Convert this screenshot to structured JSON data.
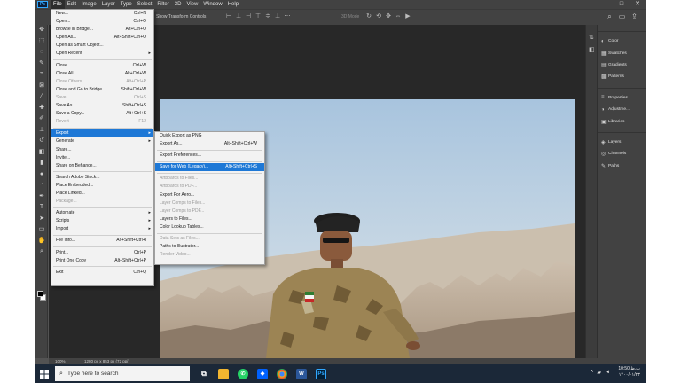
{
  "menubar": {
    "logo": "Ps",
    "items": [
      "File",
      "Edit",
      "Image",
      "Layer",
      "Type",
      "Select",
      "Filter",
      "3D",
      "View",
      "Window",
      "Help"
    ],
    "controls": [
      "–",
      "□",
      "✕"
    ]
  },
  "options": {
    "transform_label": "Show Transform Controls",
    "mode_3d": "3D Mode"
  },
  "file_menu": [
    {
      "label": "New...",
      "shortcut": "Ctrl+N"
    },
    {
      "label": "Open...",
      "shortcut": "Ctrl+O"
    },
    {
      "label": "Browse in Bridge...",
      "shortcut": "Alt+Ctrl+O"
    },
    {
      "label": "Open As...",
      "shortcut": "Alt+Shift+Ctrl+O"
    },
    {
      "label": "Open as Smart Object..."
    },
    {
      "label": "Open Recent",
      "submenu": true
    },
    {
      "sep": true
    },
    {
      "label": "Close",
      "shortcut": "Ctrl+W"
    },
    {
      "label": "Close All",
      "shortcut": "Alt+Ctrl+W"
    },
    {
      "label": "Close Others",
      "shortcut": "Alt+Ctrl+P",
      "disabled": true
    },
    {
      "label": "Close and Go to Bridge...",
      "shortcut": "Shift+Ctrl+W"
    },
    {
      "label": "Save",
      "shortcut": "Ctrl+S",
      "disabled": true
    },
    {
      "label": "Save As...",
      "shortcut": "Shift+Ctrl+S"
    },
    {
      "label": "Save a Copy...",
      "shortcut": "Alt+Ctrl+S"
    },
    {
      "label": "Revert",
      "shortcut": "F12",
      "disabled": true
    },
    {
      "sep": true
    },
    {
      "label": "Export",
      "submenu": true,
      "highlighted": true
    },
    {
      "label": "Generate",
      "submenu": true
    },
    {
      "label": "Share..."
    },
    {
      "label": "Invite..."
    },
    {
      "label": "Share on Behance..."
    },
    {
      "sep": true
    },
    {
      "label": "Search Adobe Stock..."
    },
    {
      "label": "Place Embedded..."
    },
    {
      "label": "Place Linked..."
    },
    {
      "label": "Package...",
      "disabled": true
    },
    {
      "sep": true
    },
    {
      "label": "Automate",
      "submenu": true
    },
    {
      "label": "Scripts",
      "submenu": true
    },
    {
      "label": "Import",
      "submenu": true
    },
    {
      "sep": true
    },
    {
      "label": "File Info...",
      "shortcut": "Alt+Shift+Ctrl+I"
    },
    {
      "sep": true
    },
    {
      "label": "Print...",
      "shortcut": "Ctrl+P"
    },
    {
      "label": "Print One Copy",
      "shortcut": "Alt+Shift+Ctrl+P"
    },
    {
      "sep": true
    },
    {
      "label": "Exit",
      "shortcut": "Ctrl+Q"
    }
  ],
  "export_menu": [
    {
      "label": "Quick Export as PNG"
    },
    {
      "label": "Export As...",
      "shortcut": "Alt+Shift+Ctrl+W"
    },
    {
      "sep": true
    },
    {
      "label": "Export Preferences..."
    },
    {
      "sep": true
    },
    {
      "label": "Save for Web (Legacy)...",
      "shortcut": "Alt+Shift+Ctrl+S",
      "highlighted": true
    },
    {
      "sep": true
    },
    {
      "label": "Artboards to Files...",
      "disabled": true
    },
    {
      "label": "Artboards to PDF...",
      "disabled": true
    },
    {
      "label": "Export For Aero..."
    },
    {
      "label": "Layer Comps to Files...",
      "disabled": true
    },
    {
      "label": "Layer Comps to PDF...",
      "disabled": true
    },
    {
      "label": "Layers to Files..."
    },
    {
      "label": "Color Lookup Tables..."
    },
    {
      "sep": true
    },
    {
      "label": "Data Sets as Files...",
      "disabled": true
    },
    {
      "label": "Paths to Illustrator..."
    },
    {
      "label": "Render Video...",
      "disabled": true
    }
  ],
  "panels": {
    "group1": [
      {
        "icon": "◐",
        "label": "Color"
      },
      {
        "icon": "▦",
        "label": "Swatches"
      },
      {
        "icon": "▤",
        "label": "Gradients"
      },
      {
        "icon": "▩",
        "label": "Patterns"
      }
    ],
    "group2": [
      {
        "icon": "≡",
        "label": "Properties"
      },
      {
        "icon": "◑",
        "label": "Adjustme..."
      },
      {
        "icon": "▣",
        "label": "Libraries"
      }
    ],
    "group3": [
      {
        "icon": "◈",
        "label": "Layers"
      },
      {
        "icon": "◎",
        "label": "Channels"
      },
      {
        "icon": "✎",
        "label": "Paths"
      }
    ]
  },
  "status": {
    "zoom": "100%",
    "dims": "1280 px x 853 px (72 ppi)"
  },
  "taskbar": {
    "search_placeholder": "Type here to search",
    "time": "10:50 ب.ظ",
    "date": "۱۴۰۰/۰۱/۲۳"
  },
  "colors": {
    "accent": "#1e78d6",
    "ps_blue": "#31a8ff"
  }
}
